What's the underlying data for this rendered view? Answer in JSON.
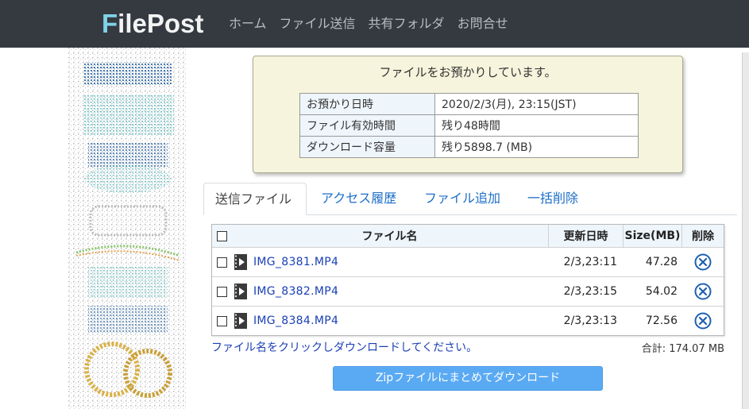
{
  "header": {
    "logo_first": "F",
    "logo_rest": "ilePost",
    "nav": [
      "ホーム",
      "ファイル送信",
      "共有フォルダ",
      "お問合せ"
    ]
  },
  "notice": {
    "title": "ファイルをお預かりしています。",
    "rows": [
      {
        "label": "お預かり日時",
        "value": "2020/2/3(月), 23:15(JST)"
      },
      {
        "label": "ファイル有効時間",
        "value": "残り48時間"
      },
      {
        "label": "ダウンロード容量",
        "value": "残り5898.7 (MB)"
      }
    ]
  },
  "tabs": [
    "送信ファイル",
    "アクセス履歴",
    "ファイル追加",
    "一括削除"
  ],
  "file_table": {
    "columns": {
      "name": "ファイル名",
      "date": "更新日時",
      "size": "Size(MB)",
      "delete": "削除"
    },
    "rows": [
      {
        "name": "IMG_8381.MP4",
        "date": "2/3,23:11",
        "size": "47.28"
      },
      {
        "name": "IMG_8382.MP4",
        "date": "2/3,23:15",
        "size": "54.02"
      },
      {
        "name": "IMG_8384.MP4",
        "date": "2/3,23:13",
        "size": "72.56"
      }
    ]
  },
  "hint": "ファイル名をクリックしダウンロードしてください。",
  "total": "合計: 174.07 MB",
  "zip_button": "Zipファイルにまとめてダウンロード",
  "colors": {
    "header_bg": "#343a40",
    "link": "#1a3fb5",
    "accent_button": "#5aaaf3",
    "notice_bg": "#f6f4dc",
    "delete_icon": "#1f5fb0"
  }
}
